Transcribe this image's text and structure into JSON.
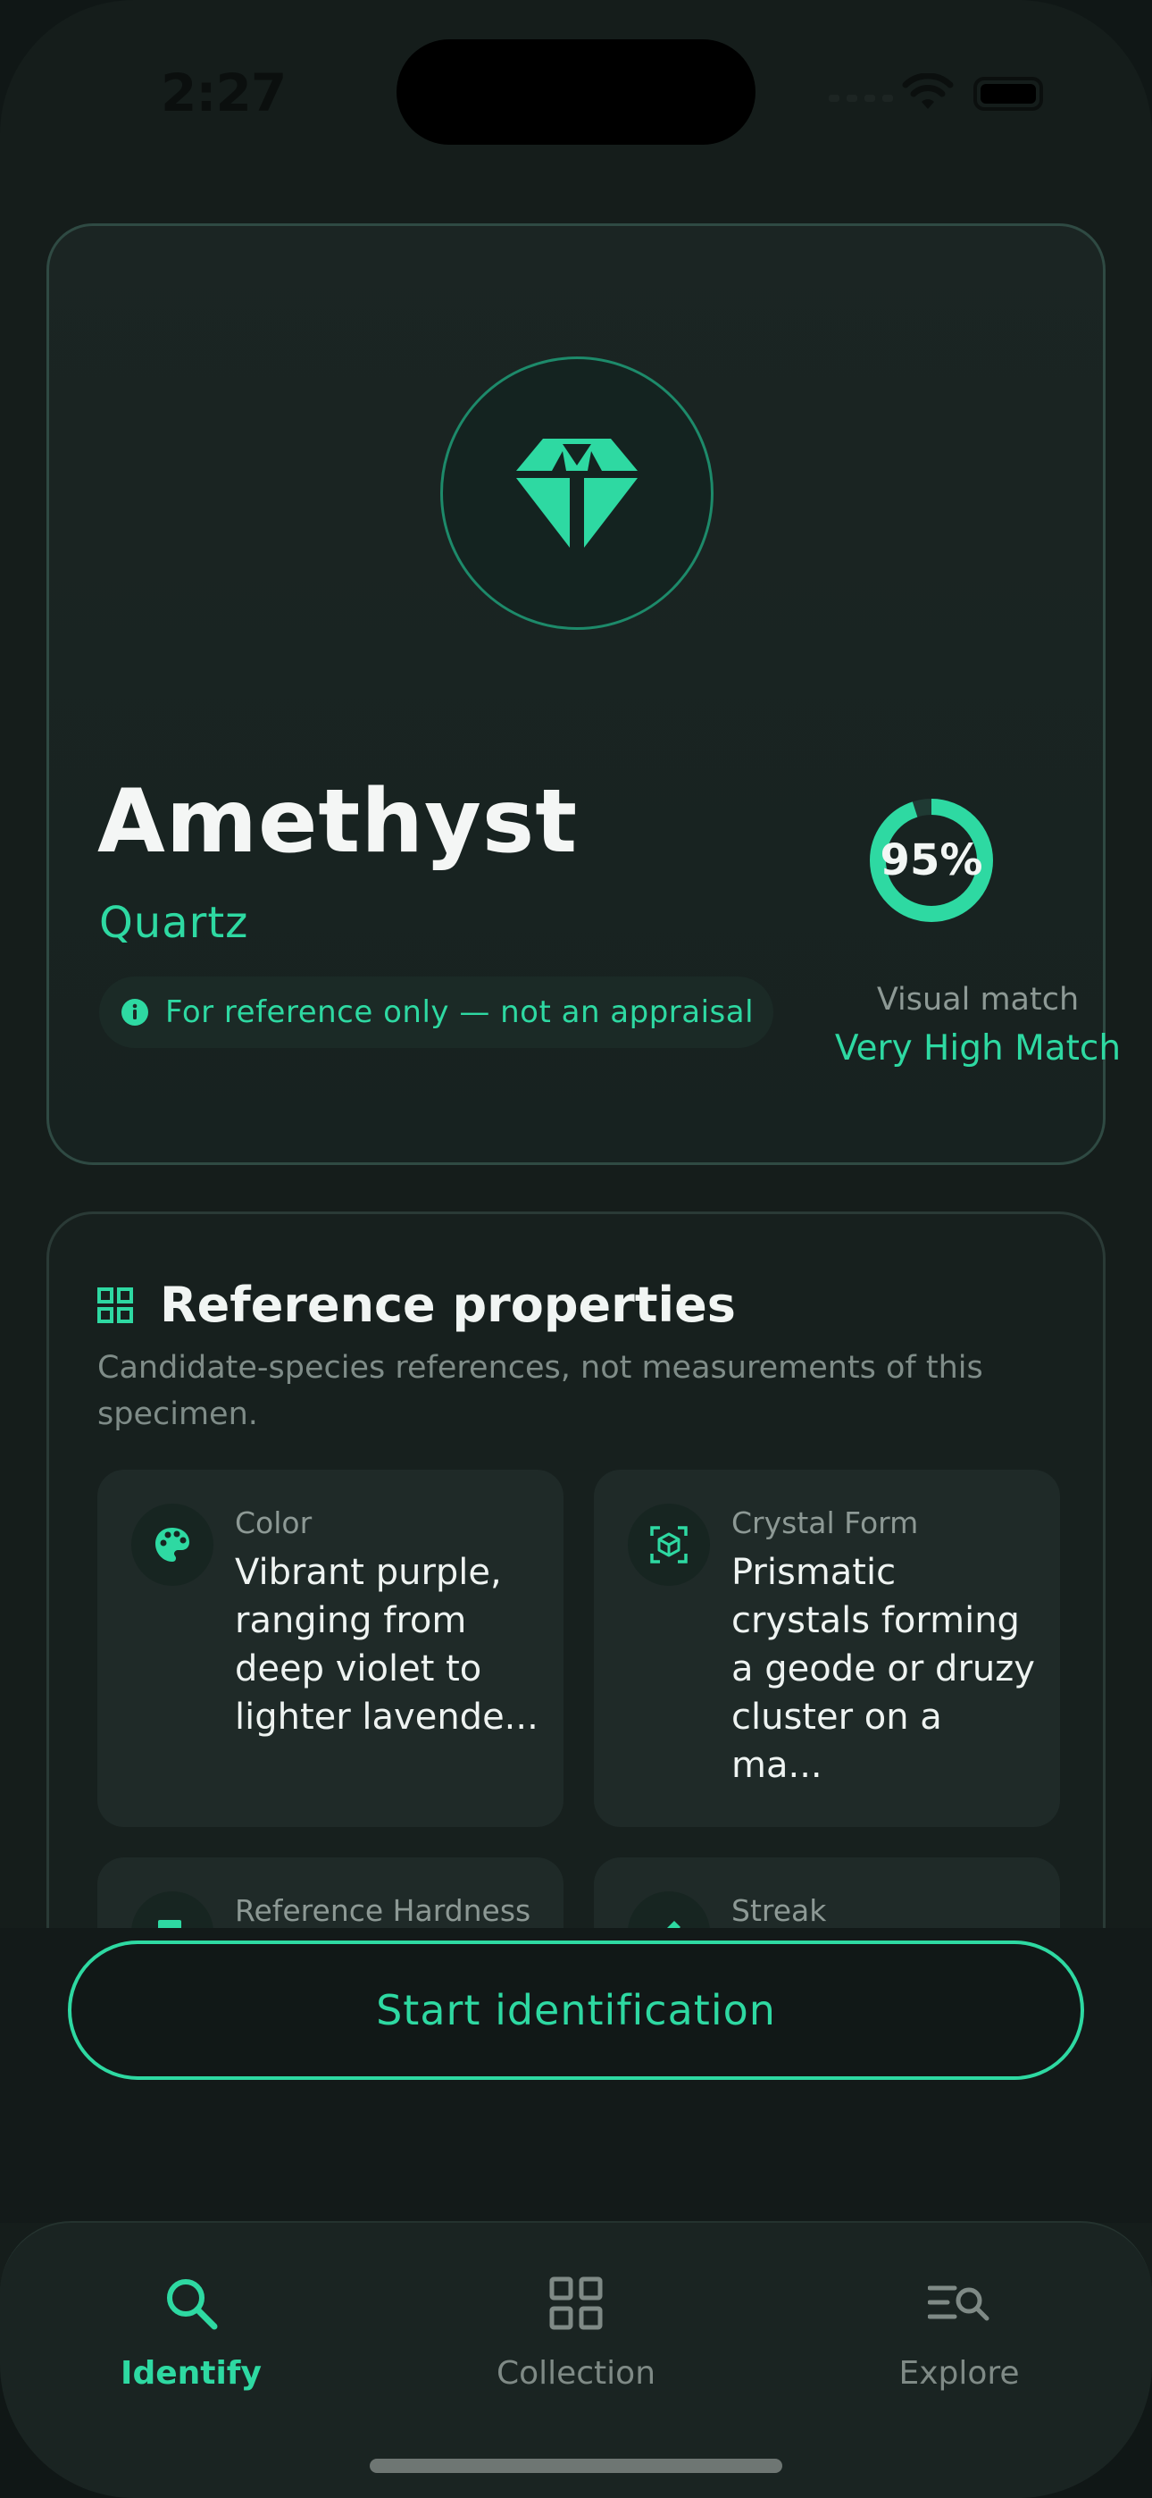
{
  "status_bar": {
    "time": "2:27"
  },
  "hero": {
    "gem_icon": "diamond-gem-icon",
    "name": "Amethyst",
    "group": "Quartz",
    "disclaimer_icon": "info-icon",
    "disclaimer": "For reference only — not an appraisal",
    "match_percent_value": 0.95,
    "match_percent_label": "95%",
    "match_caption": "Visual match",
    "match_level": "Very High Match"
  },
  "properties": {
    "icon": "grid-icon",
    "title": "Reference properties",
    "subtitle": "Candidate-species references, not measurements of this specimen.",
    "items": [
      {
        "icon": "palette-icon",
        "label": "Color",
        "value": "Vibrant purple, ranging from deep violet to lighter lavende..."
      },
      {
        "icon": "crystal-cube-icon",
        "label": "Crystal Form",
        "value": "Prismatic crystals forming a geode or druzy cluster on a ma..."
      },
      {
        "icon": "hammer-icon",
        "label": "Reference Hardness",
        "value": ""
      },
      {
        "icon": "pencil-icon",
        "label": "Streak",
        "value": ""
      }
    ]
  },
  "cta": {
    "label": "Start identification"
  },
  "tabs": [
    {
      "icon": "search-icon",
      "label": "Identify",
      "active": true
    },
    {
      "icon": "collection-grid-icon",
      "label": "Collection",
      "active": false
    },
    {
      "icon": "explore-search-icon",
      "label": "Explore",
      "active": false
    }
  ],
  "colors": {
    "accent": "#2ed9a2",
    "background": "#151d1b",
    "muted": "#8d9995"
  }
}
